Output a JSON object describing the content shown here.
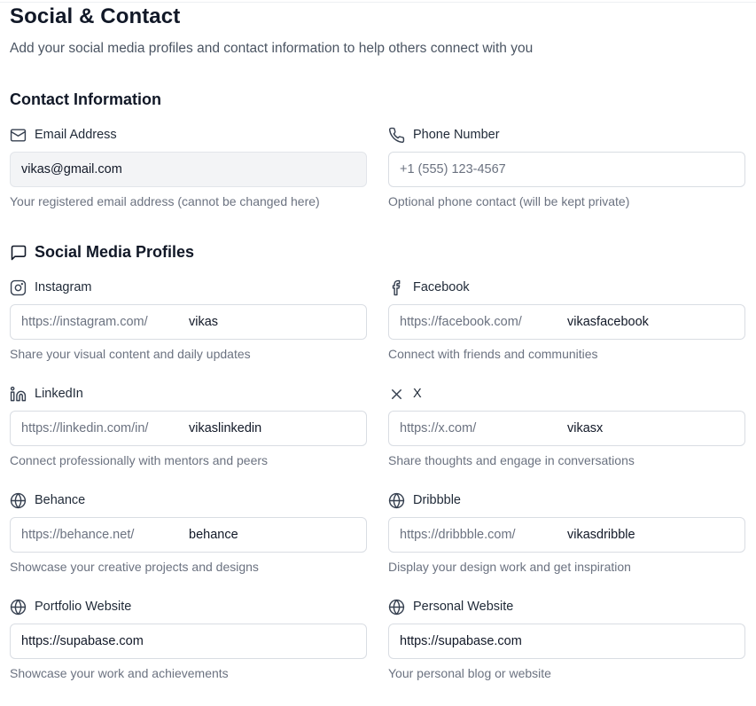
{
  "page": {
    "title": "Social & Contact",
    "subtitle": "Add your social media profiles and contact information to help others connect with you"
  },
  "contact": {
    "heading": "Contact Information",
    "email": {
      "label": "Email Address",
      "icon": "mail-icon",
      "value": "vikas@gmail.com",
      "help": "Your registered email address (cannot be changed here)"
    },
    "phone": {
      "label": "Phone Number",
      "icon": "phone-icon",
      "placeholder": "+1 (555) 123-4567",
      "help": "Optional phone contact (will be kept private)"
    }
  },
  "social": {
    "heading": "Social Media Profiles",
    "icon": "message-square-icon",
    "instagram": {
      "label": "Instagram",
      "icon": "instagram-icon",
      "prefix": "https://instagram.com/",
      "value": "vikas",
      "help": "Share your visual content and daily updates"
    },
    "facebook": {
      "label": "Facebook",
      "icon": "facebook-icon",
      "prefix": "https://facebook.com/",
      "value": "vikasfacebook",
      "help": "Connect with friends and communities"
    },
    "linkedin": {
      "label": "LinkedIn",
      "icon": "linkedin-icon",
      "prefix": "https://linkedin.com/in/",
      "value": "vikaslinkedin",
      "help": "Connect professionally with mentors and peers"
    },
    "x": {
      "label": "X",
      "icon": "x-icon",
      "prefix": "https://x.com/",
      "value": "vikasx",
      "help": "Share thoughts and engage in conversations"
    },
    "behance": {
      "label": "Behance",
      "icon": "globe-icon",
      "prefix": "https://behance.net/",
      "value": "behance",
      "help": "Showcase your creative projects and designs"
    },
    "dribbble": {
      "label": "Dribbble",
      "icon": "globe-icon",
      "prefix": "https://dribbble.com/",
      "value": "vikasdribble",
      "help": "Display your design work and get inspiration"
    },
    "portfolio": {
      "label": "Portfolio Website",
      "icon": "globe-icon",
      "value": "https://supabase.com",
      "help": "Showcase your work and achievements"
    },
    "personal": {
      "label": "Personal Website",
      "icon": "globe-icon",
      "value": "https://supabase.com",
      "help": "Your personal blog or website"
    }
  },
  "colors": {
    "text": "#111827",
    "muted": "#6b7280",
    "border": "#d9dde3",
    "disabled_bg": "#f3f4f6"
  }
}
